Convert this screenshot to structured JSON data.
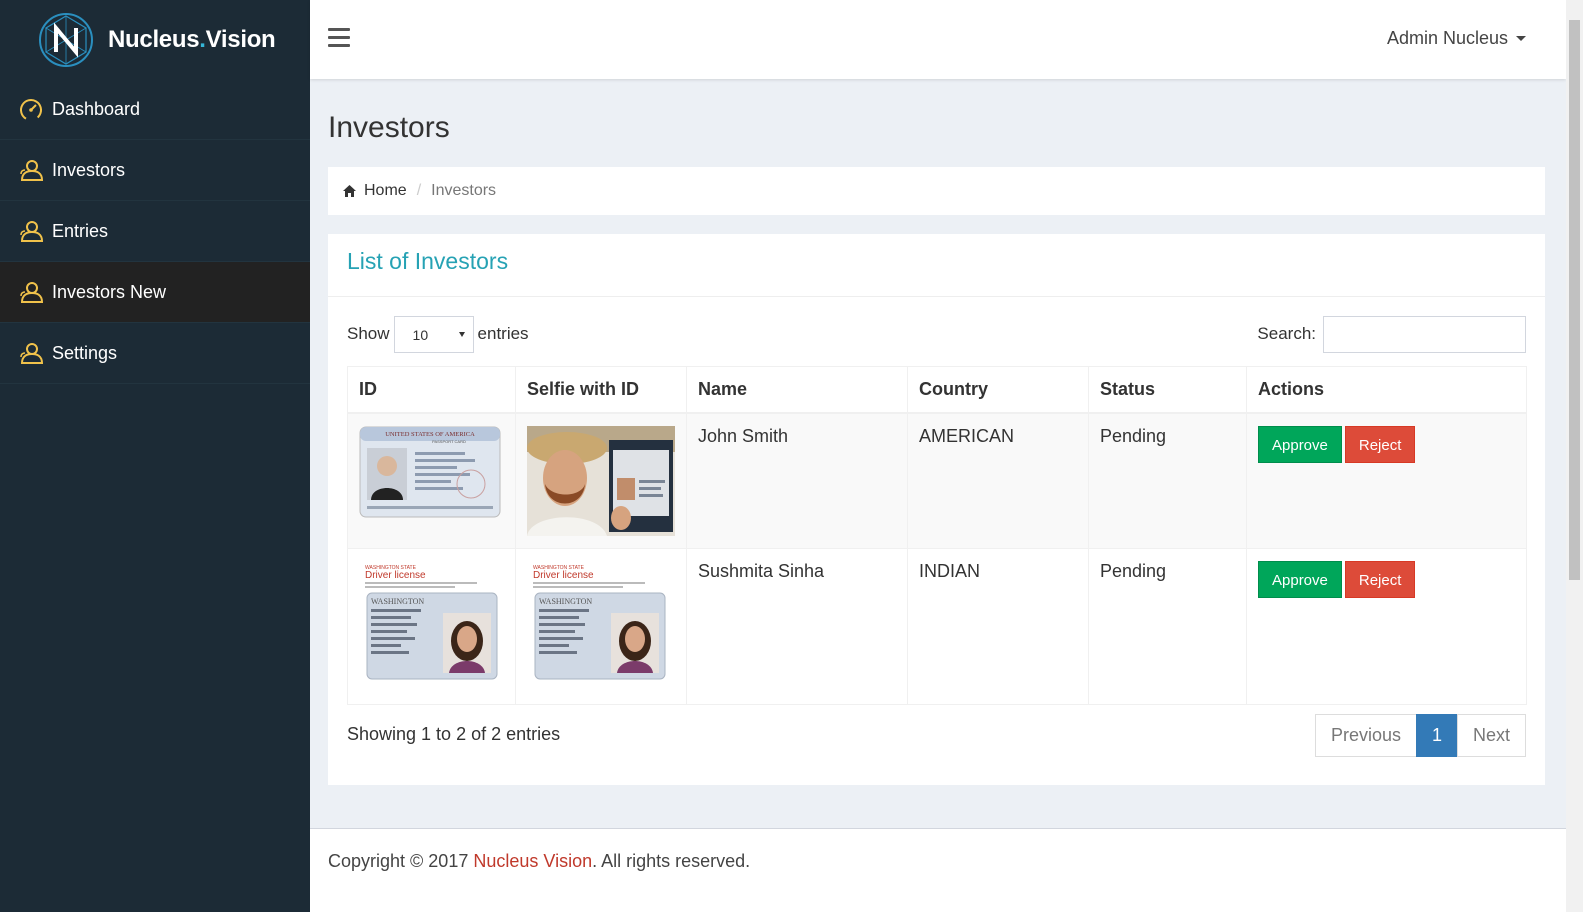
{
  "brand": {
    "name_main": "Nucleus",
    "name_dot": ".",
    "name_suffix": "Vision"
  },
  "sidebar": {
    "items": [
      {
        "label": "Dashboard",
        "icon": "speedometer-icon",
        "active": false
      },
      {
        "label": "Investors",
        "icon": "user-outline-icon",
        "active": false
      },
      {
        "label": "Entries",
        "icon": "user-outline-icon",
        "active": false
      },
      {
        "label": "Investors New",
        "icon": "user-outline-icon",
        "active": true
      },
      {
        "label": "Settings",
        "icon": "user-outline-icon",
        "active": false
      }
    ]
  },
  "topbar": {
    "user_label": "Admin Nucleus"
  },
  "page": {
    "title": "Investors"
  },
  "breadcrumb": {
    "home": "Home",
    "current": "Investors"
  },
  "box": {
    "title": "List of Investors"
  },
  "table_controls": {
    "show_label": "Show",
    "length_value": "10",
    "entries_label": "entries",
    "search_label": "Search:",
    "search_value": ""
  },
  "table": {
    "headers": [
      "ID",
      "Selfie with ID",
      "Name",
      "Country",
      "Status",
      "Actions"
    ],
    "rows": [
      {
        "id_image": "passport-card-image",
        "selfie_image": "selfie-with-passport-image",
        "name": "John Smith",
        "country": "AMERICAN",
        "status": "Pending",
        "approve": "Approve",
        "reject": "Reject"
      },
      {
        "id_image": "driver-license-image",
        "selfie_image": "driver-license-image",
        "name": "Sushmita Sinha",
        "country": "INDIAN",
        "status": "Pending",
        "approve": "Approve",
        "reject": "Reject"
      }
    ]
  },
  "id_card_text": {
    "passport_header": "UNITED STATES OF AMERICA",
    "passport_sub": "PASSPORT CARD",
    "license_state": "WASHINGTON STATE",
    "license_title": "Driver license",
    "license_card_state": "WASHINGTON"
  },
  "pagination": {
    "info": "Showing 1 to 2 of 2 entries",
    "previous": "Previous",
    "current": "1",
    "next": "Next"
  },
  "footer": {
    "prefix": "Copyright © 2017 ",
    "brand": "Nucleus Vision",
    "suffix": ". All rights reserved."
  },
  "colors": {
    "sidebar": "#1c2b36",
    "accent": "#26a2b4",
    "approve": "#00a65a",
    "reject": "#dd4b39",
    "page_active": "#337ab7"
  }
}
